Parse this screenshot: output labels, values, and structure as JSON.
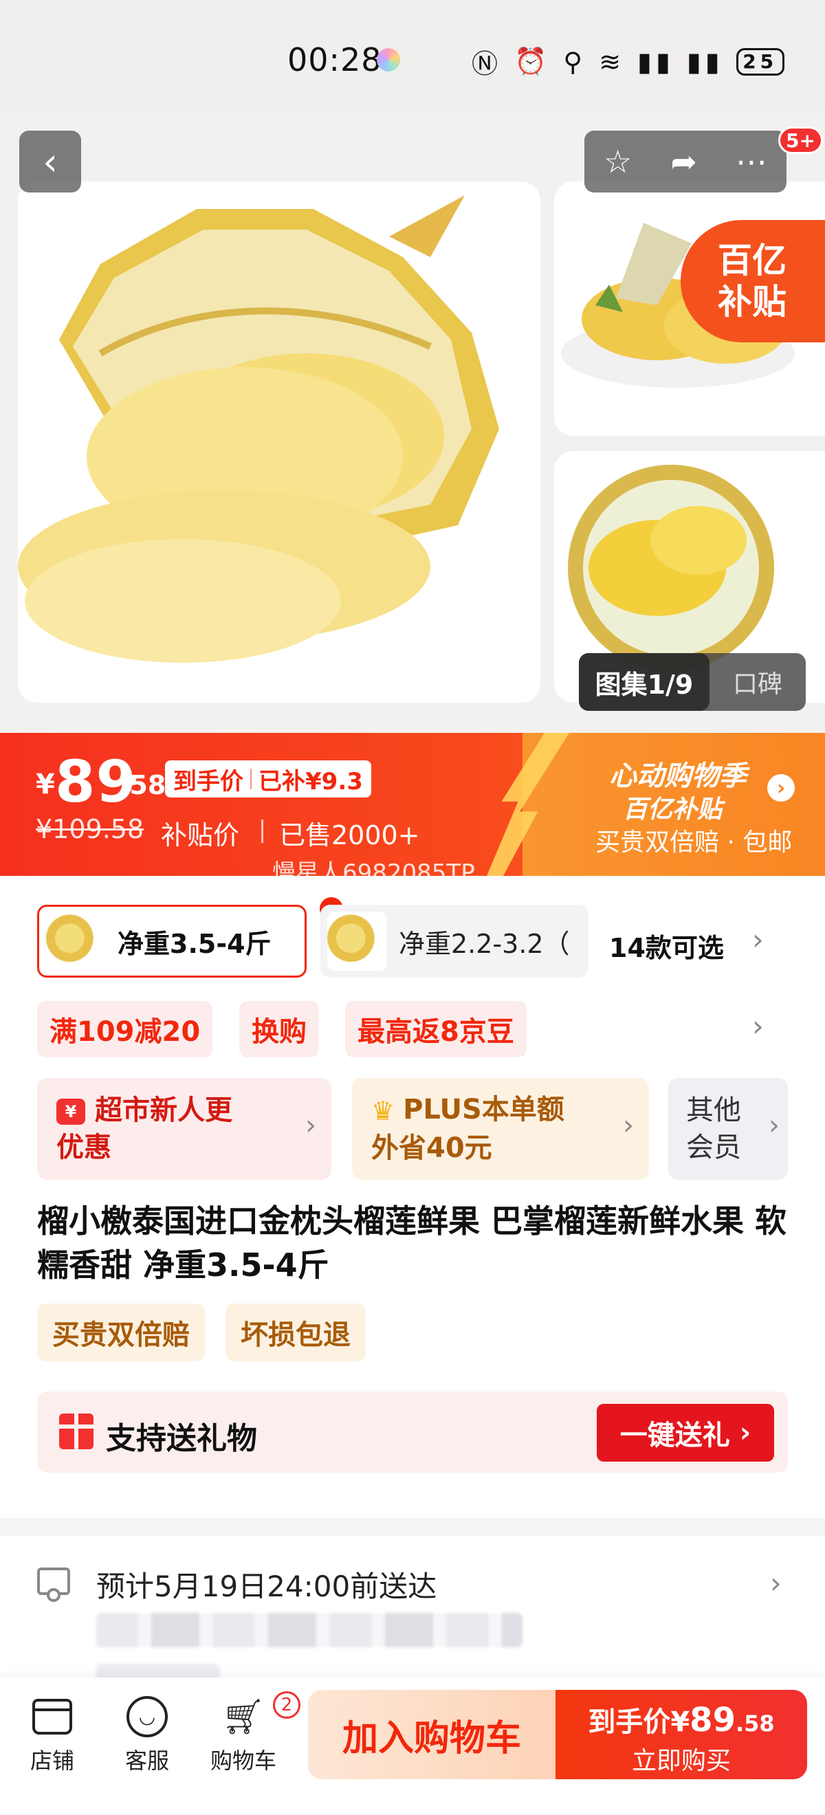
{
  "status_bar": {
    "time": "00:28",
    "icons": [
      "nfc-icon",
      "alarm-icon",
      "location-icon",
      "wifi-icon",
      "signal-4g-icon",
      "signal-5g-icon"
    ],
    "battery": "25"
  },
  "gallery": {
    "badge_count": "5+",
    "subsidy_line1": "百亿",
    "subsidy_line2": "补贴",
    "album_label": "图集1/9",
    "review_label": "口碑"
  },
  "price_bar": {
    "currency": "¥",
    "price_int": "89",
    "price_dec": ".58",
    "tag_left": "到手价",
    "tag_right": "已补¥9.3",
    "original_price": "¥109.58",
    "price_label": "补贴价",
    "sold": "已售2000+",
    "watermark": "慢星人6982085TP",
    "promo_line1": "心动购物季",
    "promo_line2": "百亿补贴",
    "promo_line3": "买贵双倍赔 · 包邮"
  },
  "variants": {
    "selected": "净重3.5-4斤",
    "other": "净重2.2-3.2（",
    "count": "14款可选"
  },
  "promotions": [
    "满109减20",
    "换购",
    "最高返8京豆"
  ],
  "membership": {
    "new_user_line1": "超市新人更",
    "new_user_line2": "优惠",
    "plus_line1": "PLUS本单额",
    "plus_line2": "外省40元",
    "other_line1": "其他",
    "other_line2": "会员"
  },
  "product": {
    "title": "榴小檄泰国进口金枕头榴莲鲜果 巴掌榴莲新鲜水果 软糯香甜 净重3.5-4斤",
    "guarantees": [
      "买贵双倍赔",
      "坏损包退"
    ]
  },
  "gift": {
    "text": "支持送礼物",
    "button": "一键送礼"
  },
  "delivery": {
    "text": "预计5月19日24:00前送达"
  },
  "bottom_bar": {
    "store": "店铺",
    "service": "客服",
    "cart": "购物车",
    "cart_badge": "2",
    "add_to_cart": "加入购物车",
    "buy_prefix": "到手价¥",
    "buy_price_int": "89",
    "buy_price_dec": ".58",
    "buy_now": "立即购买"
  },
  "colors": {
    "accent_red": "#f2270c",
    "price_gradient_start": "#f5301e",
    "price_gradient_end": "#fa8b2e",
    "plus_gold": "#a85b0a"
  }
}
